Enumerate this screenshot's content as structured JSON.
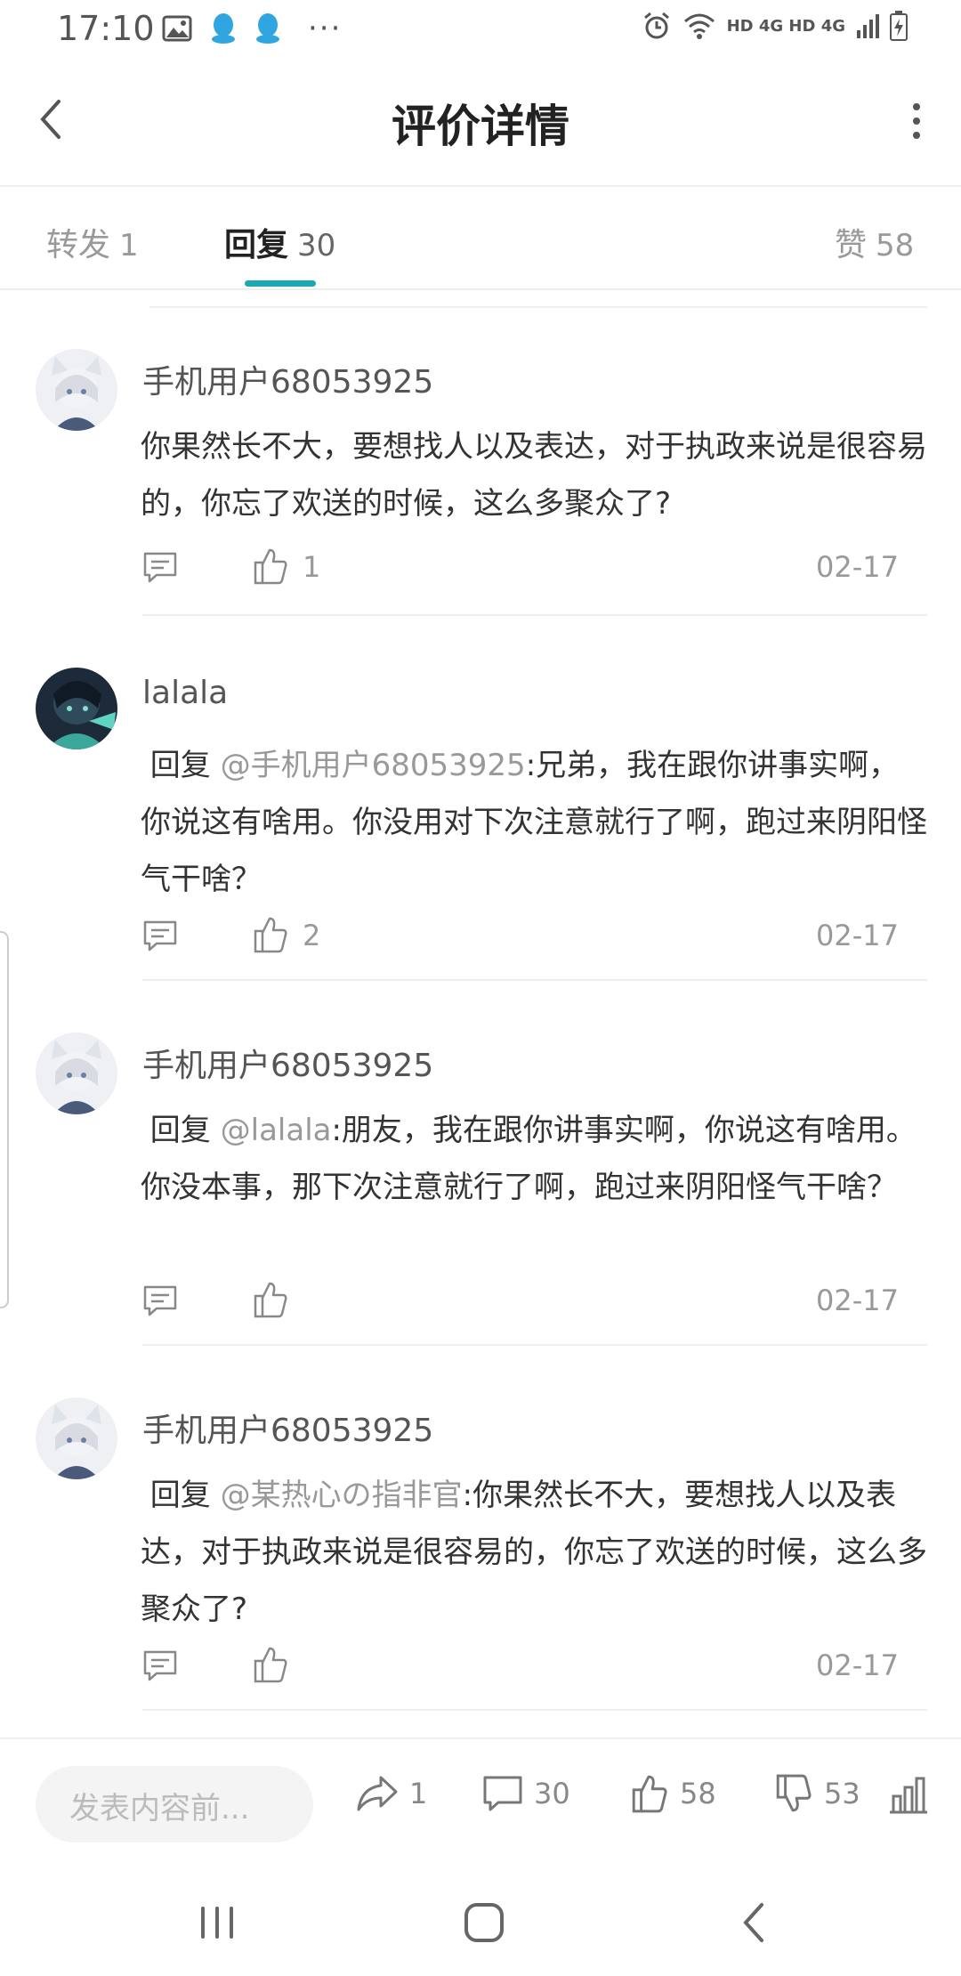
{
  "status_bar": {
    "time": "17:10",
    "dots": "···",
    "network": "HD 4G HD 4G"
  },
  "header": {
    "title": "评价详情"
  },
  "tabs": [
    {
      "label": "转发",
      "count": "1"
    },
    {
      "label": "回复",
      "count": "30"
    },
    {
      "label": "赞",
      "count": "58"
    }
  ],
  "comments": [
    {
      "user": "手机用户68053925",
      "reply_prefix": "",
      "mention": "",
      "text": "你果然长不大，要想找人以及表达，对于执政来说是很容易的，你忘了欢送的时候，这么多聚众了?",
      "likes": "1",
      "date": "02-17"
    },
    {
      "user": "lalala",
      "reply_prefix": " 回复 ",
      "mention": "@手机用户68053925",
      "text": ":兄弟，我在跟你讲事实啊，你说这有啥用。你没用对下次注意就行了啊，跑过来阴阳怪气干啥？",
      "likes": "2",
      "date": "02-17"
    },
    {
      "user": "手机用户68053925",
      "reply_prefix": " 回复 ",
      "mention": "@lalala",
      "text": ":朋友，我在跟你讲事实啊，你说这有啥用。你没本事，那下次注意就行了啊，跑过来阴阳怪气干啥？",
      "likes": "",
      "date": "02-17"
    },
    {
      "user": "手机用户68053925",
      "reply_prefix": " 回复 ",
      "mention": "@某热心の指非官",
      "text": ":你果然长不大，要想找人以及表达，对于执政来说是很容易的，你忘了欢送的时候，这么多聚众了?",
      "likes": "",
      "date": "02-17"
    }
  ],
  "bottom_bar": {
    "input_placeholder": "发表内容前...",
    "share_count": "1",
    "comment_count": "30",
    "like_count": "58",
    "dislike_count": "53"
  },
  "colors": {
    "accent": "#1aa8b6",
    "text_primary": "#333333",
    "text_secondary": "#999999",
    "divider": "#eeeeee"
  },
  "icons": [
    "image-icon",
    "qq-icon",
    "alarm-icon",
    "wifi-icon",
    "signal-icon",
    "battery-icon",
    "back-arrow-icon",
    "more-vertical-icon",
    "reply-bubble-icon",
    "thumbs-up-icon",
    "share-arrow-icon",
    "thumbs-down-icon",
    "stats-icon",
    "recents-icon",
    "home-icon",
    "nav-back-icon"
  ]
}
